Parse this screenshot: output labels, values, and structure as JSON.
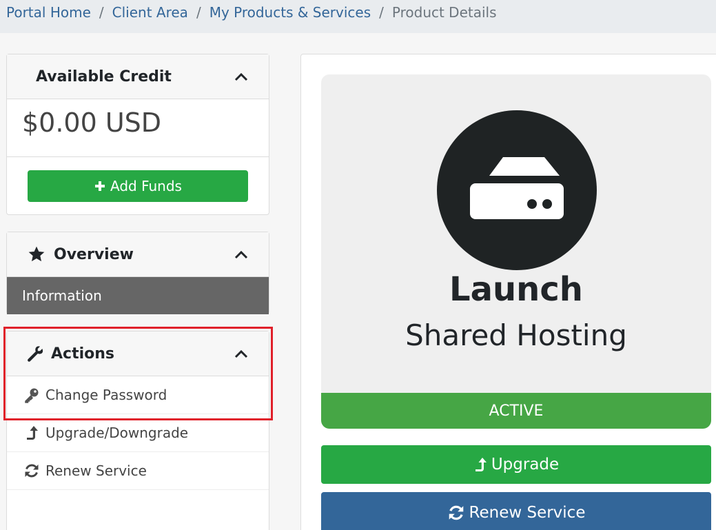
{
  "breadcrumb": {
    "items": [
      "Portal Home",
      "Client Area",
      "My Products & Services"
    ],
    "current": "Product Details"
  },
  "credit": {
    "title": "Available Credit",
    "amount": "$0.00 USD",
    "add_funds_label": "Add Funds"
  },
  "overview": {
    "title": "Overview",
    "item_label": "Information"
  },
  "actions": {
    "title": "Actions",
    "items": [
      {
        "label": "Change Password",
        "icon": "key-icon"
      },
      {
        "label": "Upgrade/Downgrade",
        "icon": "level-up-icon"
      },
      {
        "label": "Renew Service",
        "icon": "sync-icon"
      }
    ]
  },
  "product": {
    "name": "Launch",
    "group": "Shared Hosting",
    "status": "ACTIVE",
    "icon": "hdd-icon"
  },
  "buttons": {
    "upgrade_label": "Upgrade",
    "renew_label": "Renew Service"
  },
  "colors": {
    "green": "#27a844",
    "status_green": "#46a645",
    "blue": "#336699",
    "highlight_red": "#e0202a"
  }
}
